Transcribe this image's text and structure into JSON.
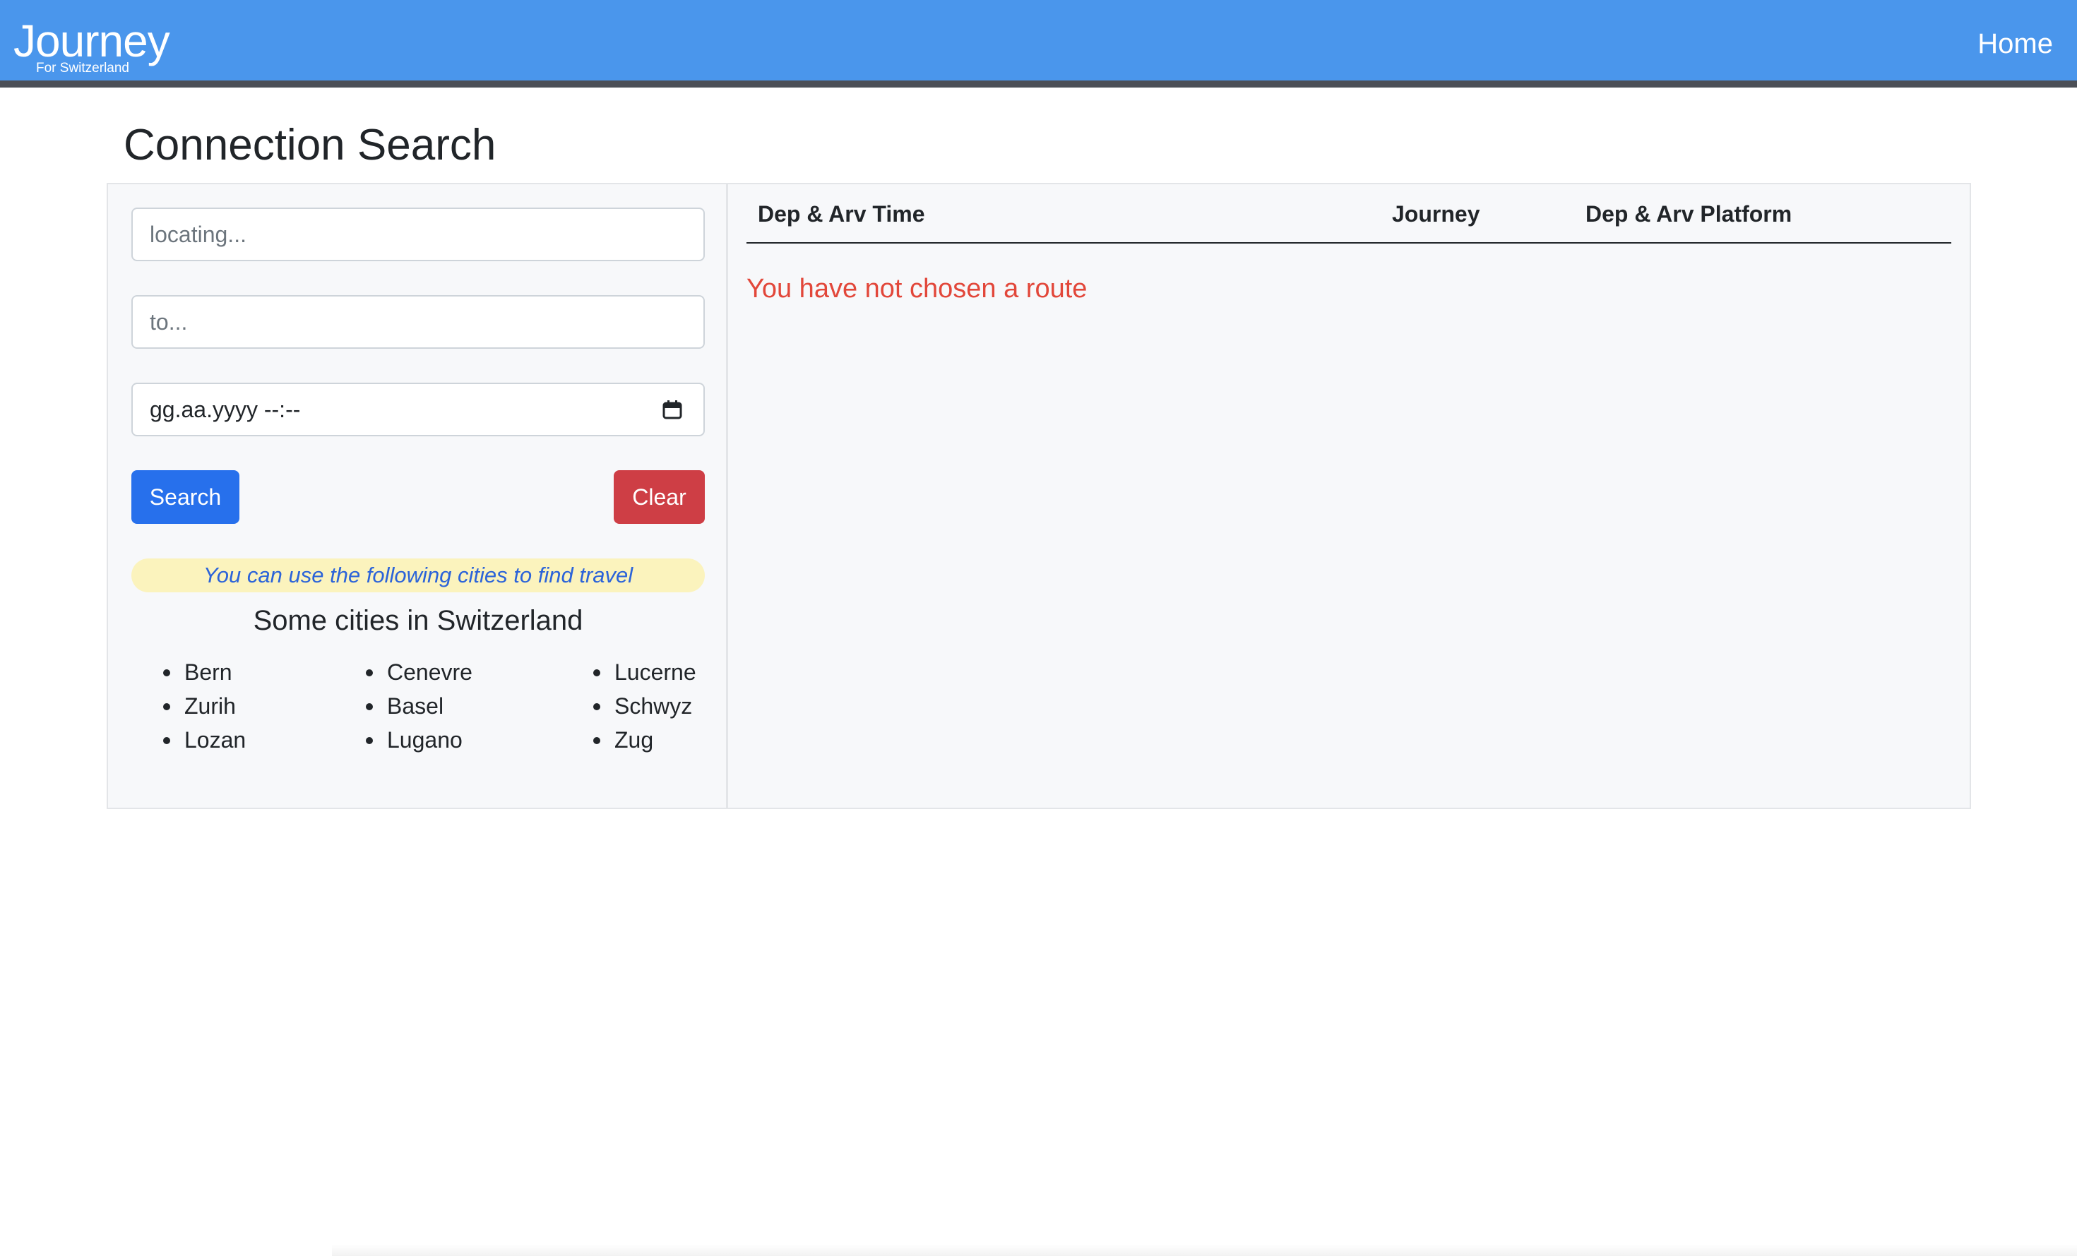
{
  "navbar": {
    "brand_title": "Journey",
    "brand_subtitle": "For Switzerland",
    "home_label": "Home"
  },
  "page": {
    "title": "Connection Search"
  },
  "search_form": {
    "from_placeholder": "locating...",
    "to_placeholder": "to...",
    "datetime_placeholder": "gg.aa.yyyy --:--",
    "search_label": "Search",
    "clear_label": "Clear"
  },
  "cities": {
    "hint": "You can use the following cities to find travel",
    "heading": "Some cities in Switzerland",
    "columns": [
      [
        "Bern",
        "Zurih",
        "Lozan"
      ],
      [
        "Cenevre",
        "Basel",
        "Lugano"
      ],
      [
        "Lucerne",
        "Schwyz",
        "Zug"
      ]
    ]
  },
  "results": {
    "headers": [
      "Dep & Arv Time",
      "Journey",
      "Dep & Arv Platform"
    ],
    "empty_message": "You have not chosen a route"
  },
  "colors": {
    "navbar": "#4a96ec",
    "search_button": "#2770ec",
    "clear_button": "#ce3e45",
    "empty_message": "#e2473a",
    "hint_background": "#fbf3bd"
  },
  "icons": {
    "datetime": "calendar-icon"
  }
}
